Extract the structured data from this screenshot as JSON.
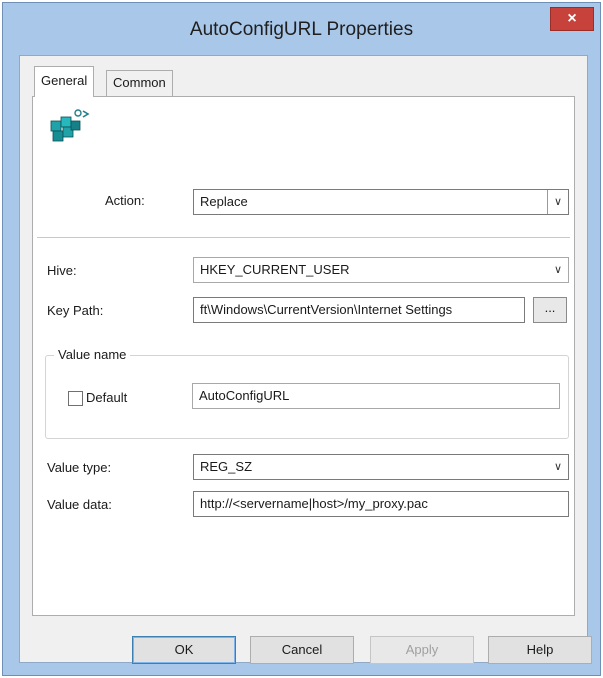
{
  "window": {
    "title": "AutoConfigURL Properties",
    "close_glyph": "×"
  },
  "tabs": [
    {
      "label": "General",
      "active": true
    },
    {
      "label": "Common",
      "active": false
    }
  ],
  "general": {
    "icon": "registry-cubes-icon",
    "action": {
      "label": "Action:",
      "value": "Replace"
    },
    "hive": {
      "label": "Hive:",
      "value": "HKEY_CURRENT_USER"
    },
    "key_path": {
      "label": "Key Path:",
      "value": "ft\\Windows\\CurrentVersion\\Internet Settings",
      "browse_label": "..."
    },
    "value_name": {
      "group_label": "Value name",
      "default_label": "Default",
      "default_checked": false,
      "value": "AutoConfigURL"
    },
    "value_type": {
      "label": "Value type:",
      "value": "REG_SZ"
    },
    "value_data": {
      "label": "Value data:",
      "value": "http://<servername|host>/my_proxy.pac"
    }
  },
  "buttons": {
    "ok": "OK",
    "cancel": "Cancel",
    "apply": "Apply",
    "help": "Help"
  },
  "colors": {
    "frame": "#a9c7e8",
    "close": "#c7423a",
    "panel": "#ffffff"
  }
}
